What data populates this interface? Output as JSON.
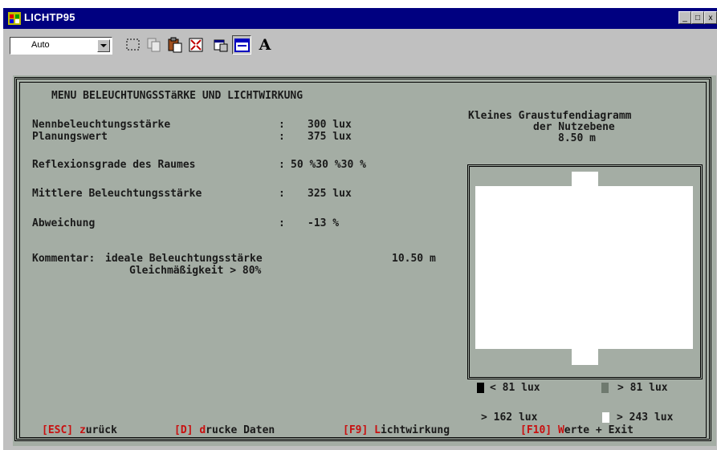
{
  "window": {
    "title": "LICHTP95",
    "controls": {
      "minimize": "_",
      "maximize": "□",
      "close": "x"
    }
  },
  "toolbar": {
    "font_size_value": "Auto",
    "tools": [
      "select-icon",
      "copy-icon",
      "paste-icon",
      "fullscreen-icon",
      "properties-icon",
      "background-icon",
      "font-icon"
    ],
    "font_label": "A"
  },
  "menu": {
    "title": "MENU BELEUCHTUNGSSTäRKE UND LICHTWIRKUNG",
    "rows": [
      {
        "label": "Nennbeleuchtungsstärke",
        "sep": ":",
        "value": "300 lux"
      },
      {
        "label": "Planungswert",
        "sep": ":",
        "value": "375 lux"
      },
      {
        "label": "Reflexionsgrade des Raumes",
        "sep": ":",
        "value": "50 %30 %30 %"
      },
      {
        "label": "Mittlere Beleuchtungsstärke",
        "sep": ":",
        "value": "325 lux"
      },
      {
        "label": "Abweichung",
        "sep": ":",
        "value": "-13 %"
      }
    ],
    "comment_label": "Kommentar:",
    "comment_line1": "ideale Beleuchtungsstärke",
    "comment_line2": "Gleichmäßigkeit > 80%",
    "comment_dimension": "10.50 m"
  },
  "diagram": {
    "title_line1": "Kleines Graustufendiagramm",
    "title_line2": "der Nutzebene",
    "title_line3": "8.50 m",
    "legend": [
      {
        "color": "#000000",
        "text": "< 81 lux"
      },
      {
        "color": "#6f7a6f",
        "text": "> 81 lux"
      },
      {
        "color": "#a4ada4",
        "text": "> 162 lux"
      },
      {
        "color": "#ffffff",
        "text": "> 243 lux"
      }
    ]
  },
  "keys": [
    {
      "key": "[ESC]",
      "first": "z",
      "rest": "urück"
    },
    {
      "key": "[D]",
      "first": "d",
      "rest": "rucke Daten"
    },
    {
      "key": "[F9]",
      "first": "L",
      "rest": "ichtwirkung"
    },
    {
      "key": "[F10]",
      "first": "W",
      "rest": "erte + Exit"
    }
  ],
  "colors": {
    "titlebar": "#000080",
    "console_bg": "#a4ada4",
    "key_red": "#c81010"
  }
}
